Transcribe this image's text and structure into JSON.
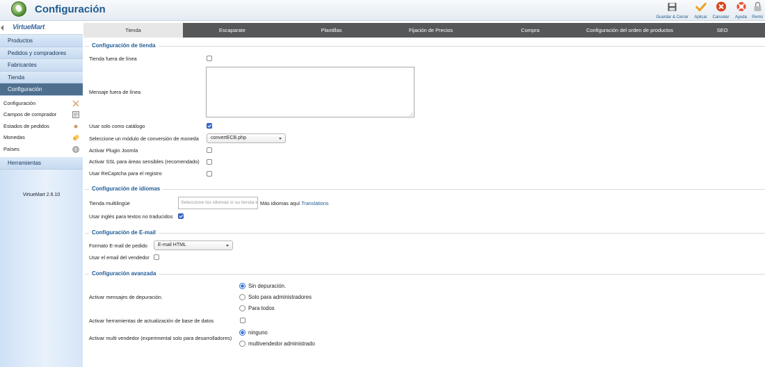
{
  "header": {
    "title": "Configuración",
    "toolbar": [
      {
        "label": "Guardar & Cerrar",
        "icon": "save-icon"
      },
      {
        "label": "Aplicar",
        "icon": "check-icon"
      },
      {
        "label": "Cancelar",
        "icon": "cancel-icon"
      },
      {
        "label": "Ayuda",
        "icon": "help-icon"
      },
      {
        "label": "Permi",
        "icon": "lock-icon"
      }
    ]
  },
  "sidebar": {
    "brand": "VirtueMart",
    "menu": [
      {
        "label": "Productos"
      },
      {
        "label": "Pedidos y compradores"
      },
      {
        "label": "Fabricantes"
      },
      {
        "label": "Tienda"
      },
      {
        "label": "Configuración",
        "active": true
      }
    ],
    "submenu": [
      {
        "label": "Configuración",
        "icon": "tools-icon"
      },
      {
        "label": "Campos de comprador",
        "icon": "form-icon"
      },
      {
        "label": "Estados de pedidos",
        "icon": "status-icon"
      },
      {
        "label": "Monedas",
        "icon": "coins-icon"
      },
      {
        "label": "Países",
        "icon": "globe-icon"
      }
    ],
    "tools": "Herramientas",
    "version": "VirtueMart 2.6.10"
  },
  "tabs": [
    {
      "label": "Tienda",
      "active": true
    },
    {
      "label": "Escaparate"
    },
    {
      "label": "Plantillas"
    },
    {
      "label": "Fijación de Precios"
    },
    {
      "label": "Compra"
    },
    {
      "label": "Configuración del orden de productos"
    },
    {
      "label": "SEO"
    }
  ],
  "shop": {
    "title": "Configuración de tienda",
    "offline_label": "Tienda fuera de línea",
    "offline_msg_label": "Mensaje fuera de línea",
    "offline_msg_value": "",
    "catalog_label": "Usar solo como catálogo",
    "catalog_checked": true,
    "currency_module_label": "Seleccione un módulo de conversión de moneda",
    "currency_module_value": "convertECB.php",
    "joomla_plugin_label": "Activar Plugin Joomla",
    "ssl_label": "Activar SSL para áreas sensibles (recomendado)",
    "recaptcha_label": "Usar ReCaptcha para el registro"
  },
  "languages": {
    "title": "Configuración de idiomas",
    "multilang_label": "Tienda multilingüe",
    "multilang_placeholder": "Seleccione los idiomas si su tienda es multilingüe",
    "more_text": "Más idiomas aquí",
    "more_link": "Translations",
    "english_label": "Usar inglés para textos no traducidos",
    "english_checked": true
  },
  "email": {
    "title": "Configuración de E-mail",
    "format_label": "Formato E-mail de pedido",
    "format_value": "E-mail HTML",
    "vendor_email_label": "Usar el email del vendedor"
  },
  "advanced": {
    "title": "Configuración avanzada",
    "debug_label": "Activar mensajes de depuración.",
    "debug_options": [
      {
        "label": "Sin depuración.",
        "selected": true
      },
      {
        "label": "Solo para administradores",
        "selected": false
      },
      {
        "label": "Para todos",
        "selected": false
      }
    ],
    "db_tools_label": "Activar herramientas de actualización de base de datos",
    "multivendor_label": "Activar multi vendedor (experimental solo para desarrolladores)",
    "multivendor_options": [
      {
        "label": "ninguno",
        "selected": true
      },
      {
        "label": "multivendedor administrado",
        "selected": false
      }
    ]
  }
}
